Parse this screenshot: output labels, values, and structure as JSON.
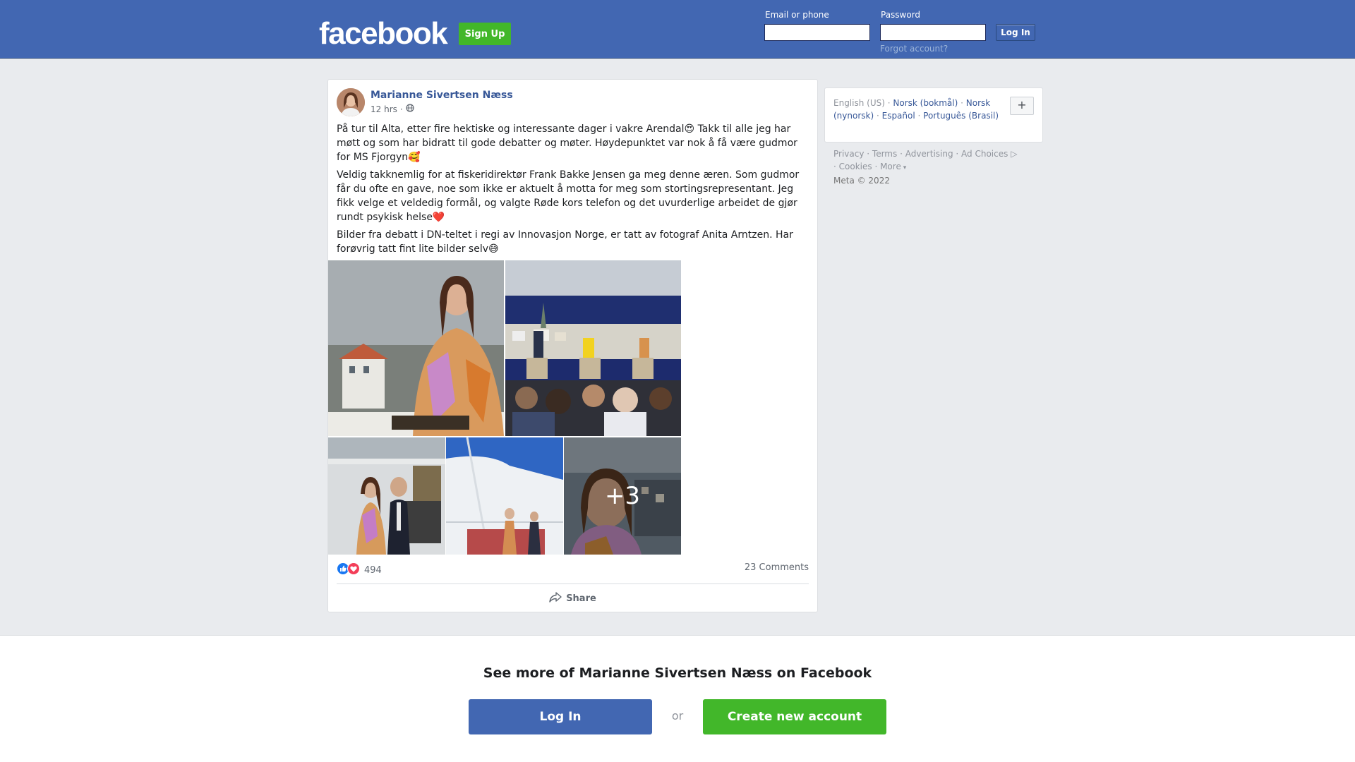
{
  "header": {
    "logo": "facebook",
    "signup_label": "Sign Up",
    "email_label": "Email or phone",
    "password_label": "Password",
    "login_label": "Log In",
    "forgot_label": "Forgot account?"
  },
  "post": {
    "author": "Marianne Sivertsen Næss",
    "time": "12 hrs",
    "privacy_icon": "globe-icon",
    "paragraphs": [
      "På tur til Alta, etter fire hektiske og interessante dager i vakre Arendal😍 Takk til alle jeg har møtt og som har bidratt til gode debatter og møter. Høydepunktet var nok å få være gudmor for MS Fjorgyn🥰",
      "Veldig takknemlig for at fiskeridirektør Frank Bakke Jensen ga meg denne æren. Som gudmor får du ofte en gave, noe som ikke er aktuelt å motta for meg som stortingsrepresentant. Jeg fikk velge et veldedig formål, og valgte Røde kors telefon og det uvurderlige arbeidet de gjør rundt psykisk helse❤️",
      "Bilder fra debatt i DN-teltet i regi av Innovasjon Norge, er tatt av fotograf Anita Arntzen. Har forøvrig tatt fint lite bilder selv😅"
    ],
    "more_photos": "+3",
    "reaction_count": "494",
    "comments": "23 Comments",
    "share_label": "Share"
  },
  "sidebar": {
    "languages": [
      "English (US)",
      "Norsk (bokmål)",
      "Norsk (nynorsk)",
      "Español",
      "Português (Brasil)"
    ],
    "plus_label": "+",
    "footer_links": [
      "Privacy",
      "Terms",
      "Advertising",
      "Ad Choices",
      "Cookies",
      "More"
    ],
    "copyright": "Meta © 2022"
  },
  "banner": {
    "title": "See more of Marianne Sivertsen Næss on Facebook",
    "login_label": "Log In",
    "or_label": "or",
    "create_label": "Create new account"
  },
  "colors": {
    "brand_blue": "#4267b2",
    "green": "#42b72a",
    "link_blue": "#385898",
    "background": "#e9ebee"
  }
}
